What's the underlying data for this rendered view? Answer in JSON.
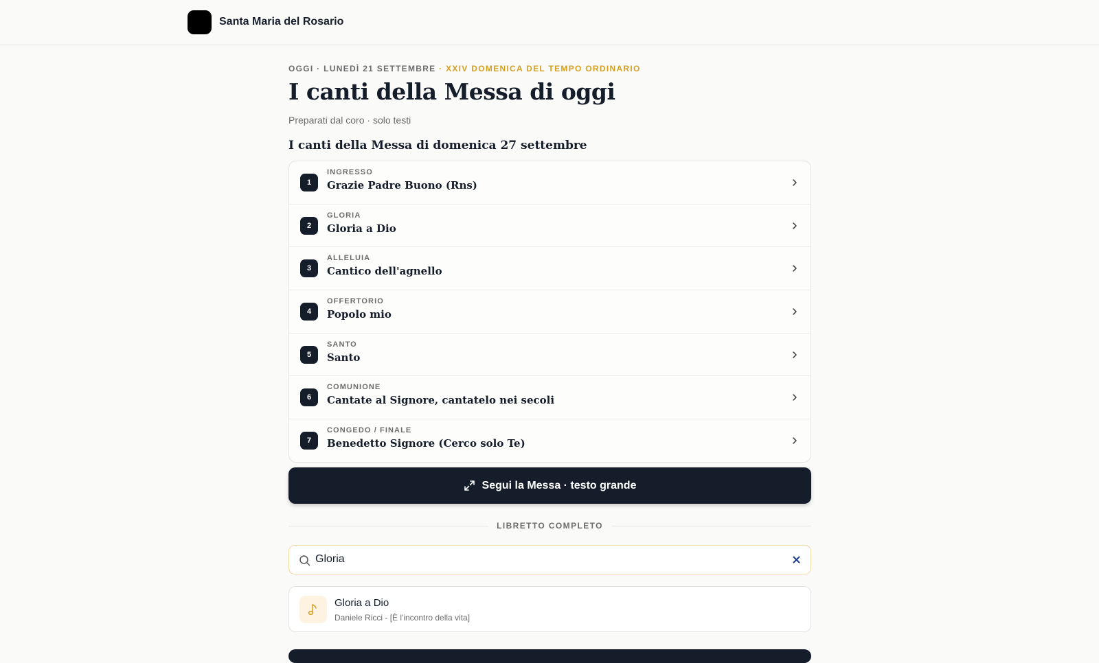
{
  "header": {
    "parish_name": "Santa Maria del Rosario"
  },
  "hero": {
    "date_prefix": "OGGI · LUNEDÌ 21 SETTEMBRE",
    "date_accent": " · XXIV DOMENICA DEL TEMPO ORDINARIO",
    "title": "I canti della Messa di oggi",
    "subtitle": "Preparati dal coro · solo testi"
  },
  "songs_section": {
    "title": "I canti della Messa di domenica 27 settembre",
    "items": [
      {
        "number": "1",
        "label": "INGRESSO",
        "title": "Grazie Padre Buono (Rns)"
      },
      {
        "number": "2",
        "label": "GLORIA",
        "title": "Gloria a Dio"
      },
      {
        "number": "3",
        "label": "ALLELUIA",
        "title": "Cantico dell'agnello"
      },
      {
        "number": "4",
        "label": "OFFERTORIO",
        "title": "Popolo mio"
      },
      {
        "number": "5",
        "label": "SANTO",
        "title": "Santo"
      },
      {
        "number": "6",
        "label": "COMUNIONE",
        "title": "Cantate al Signore, cantatelo nei secoli"
      },
      {
        "number": "7",
        "label": "CONGEDO / FINALE",
        "title": "Benedetto Signore (Cerco solo Te)"
      }
    ]
  },
  "follow_button": {
    "label": "Segui la Messa · testo grande"
  },
  "booklet": {
    "divider_label": "LIBRETTO COMPLETO",
    "search_value": "Gloria",
    "results": [
      {
        "title": "Gloria a Dio",
        "subtitle": "Daniele Ricci - [È l'incontro della vita]"
      }
    ]
  },
  "colors": {
    "primary": "#151d2b",
    "accent": "#d6a01e",
    "muted": "#6b6b6b",
    "clear_icon": "#1f3a8a"
  }
}
